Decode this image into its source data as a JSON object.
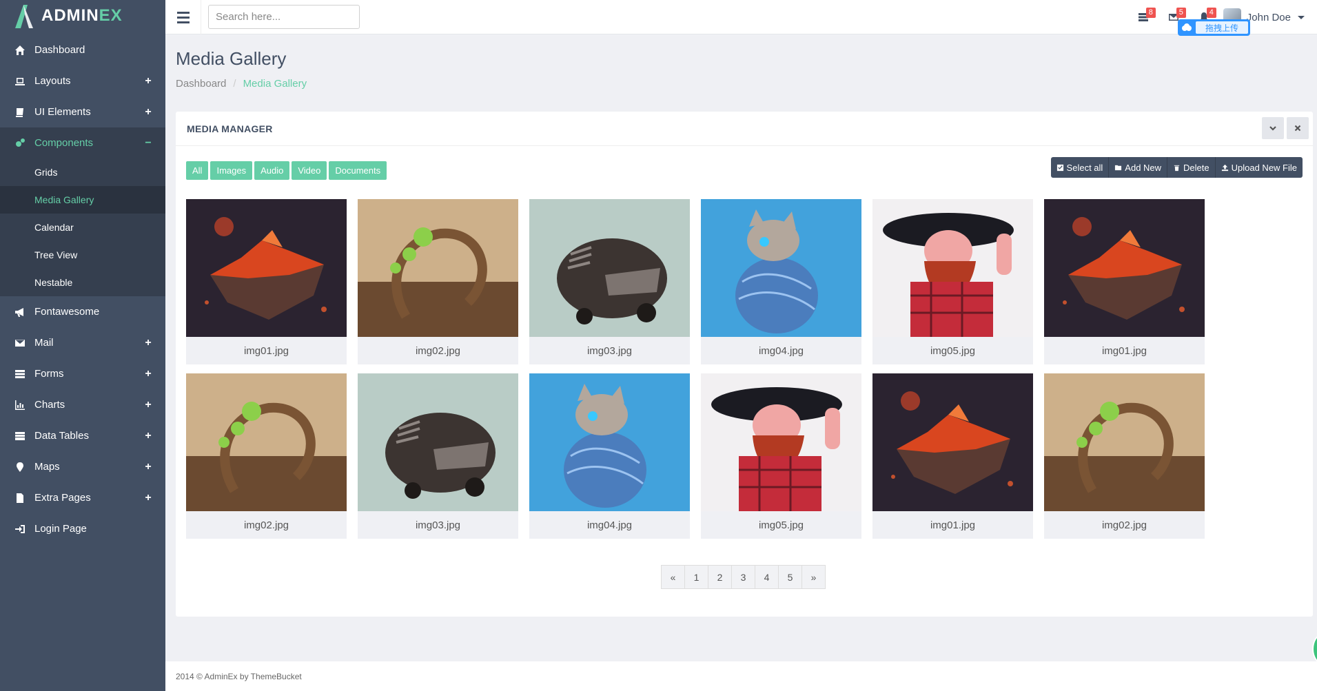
{
  "brand": {
    "name_main": "ADMIN",
    "name_accent": "EX"
  },
  "sidebar": {
    "items": [
      {
        "label": "Dashboard",
        "icon": "home-icon",
        "expand": ""
      },
      {
        "label": "Layouts",
        "icon": "laptop-icon",
        "expand": "+"
      },
      {
        "label": "UI Elements",
        "icon": "book-icon",
        "expand": "+"
      },
      {
        "label": "Components",
        "icon": "cogs-icon",
        "expand": "−",
        "active": true
      },
      {
        "label": "Fontawesome",
        "icon": "bullhorn-icon",
        "expand": ""
      },
      {
        "label": "Mail",
        "icon": "envelope-icon",
        "expand": "+"
      },
      {
        "label": "Forms",
        "icon": "tasks-icon",
        "expand": "+"
      },
      {
        "label": "Charts",
        "icon": "bar-chart-icon",
        "expand": "+"
      },
      {
        "label": "Data Tables",
        "icon": "table-icon",
        "expand": "+"
      },
      {
        "label": "Maps",
        "icon": "map-marker-icon",
        "expand": "+"
      },
      {
        "label": "Extra Pages",
        "icon": "file-icon",
        "expand": "+"
      },
      {
        "label": "Login Page",
        "icon": "sign-in-icon",
        "expand": ""
      }
    ],
    "subitems": [
      {
        "label": "Grids"
      },
      {
        "label": "Media Gallery",
        "active": true
      },
      {
        "label": "Calendar"
      },
      {
        "label": "Tree View"
      },
      {
        "label": "Nestable"
      }
    ]
  },
  "header": {
    "search_placeholder": "Search here...",
    "badges": {
      "tasks": "8",
      "mail": "5",
      "notifications": "4"
    },
    "user_name": "John Doe",
    "upload_pill_text": "拖拽上传"
  },
  "page": {
    "title": "Media Gallery",
    "breadcrumb": {
      "root": "Dashboard",
      "separator": "/",
      "current": "Media Gallery"
    }
  },
  "panel": {
    "title": "MEDIA MANAGER",
    "filters": [
      "All",
      "Images",
      "Audio",
      "Video",
      "Documents"
    ],
    "actions": [
      "Select all",
      "Add New",
      "Delete",
      "Upload New File"
    ],
    "files": [
      {
        "name": "img01.jpg",
        "kind": "island"
      },
      {
        "name": "img02.jpg",
        "kind": "tree"
      },
      {
        "name": "img03.jpg",
        "kind": "car"
      },
      {
        "name": "img04.jpg",
        "kind": "cat"
      },
      {
        "name": "img05.jpg",
        "kind": "man"
      },
      {
        "name": "img01.jpg",
        "kind": "island"
      },
      {
        "name": "img02.jpg",
        "kind": "tree"
      },
      {
        "name": "img03.jpg",
        "kind": "car"
      },
      {
        "name": "img04.jpg",
        "kind": "cat"
      },
      {
        "name": "img05.jpg",
        "kind": "man"
      },
      {
        "name": "img01.jpg",
        "kind": "island"
      },
      {
        "name": "img02.jpg",
        "kind": "tree"
      }
    ],
    "pagination": [
      "«",
      "1",
      "2",
      "3",
      "4",
      "5",
      "»"
    ]
  },
  "footer": {
    "text": "2014 © AdminEx by ThemeBucket"
  },
  "colors": {
    "accent": "#65cea7",
    "sidebar": "#424f63",
    "sidebar_dark": "#353f4f",
    "badge": "#ef5350"
  }
}
